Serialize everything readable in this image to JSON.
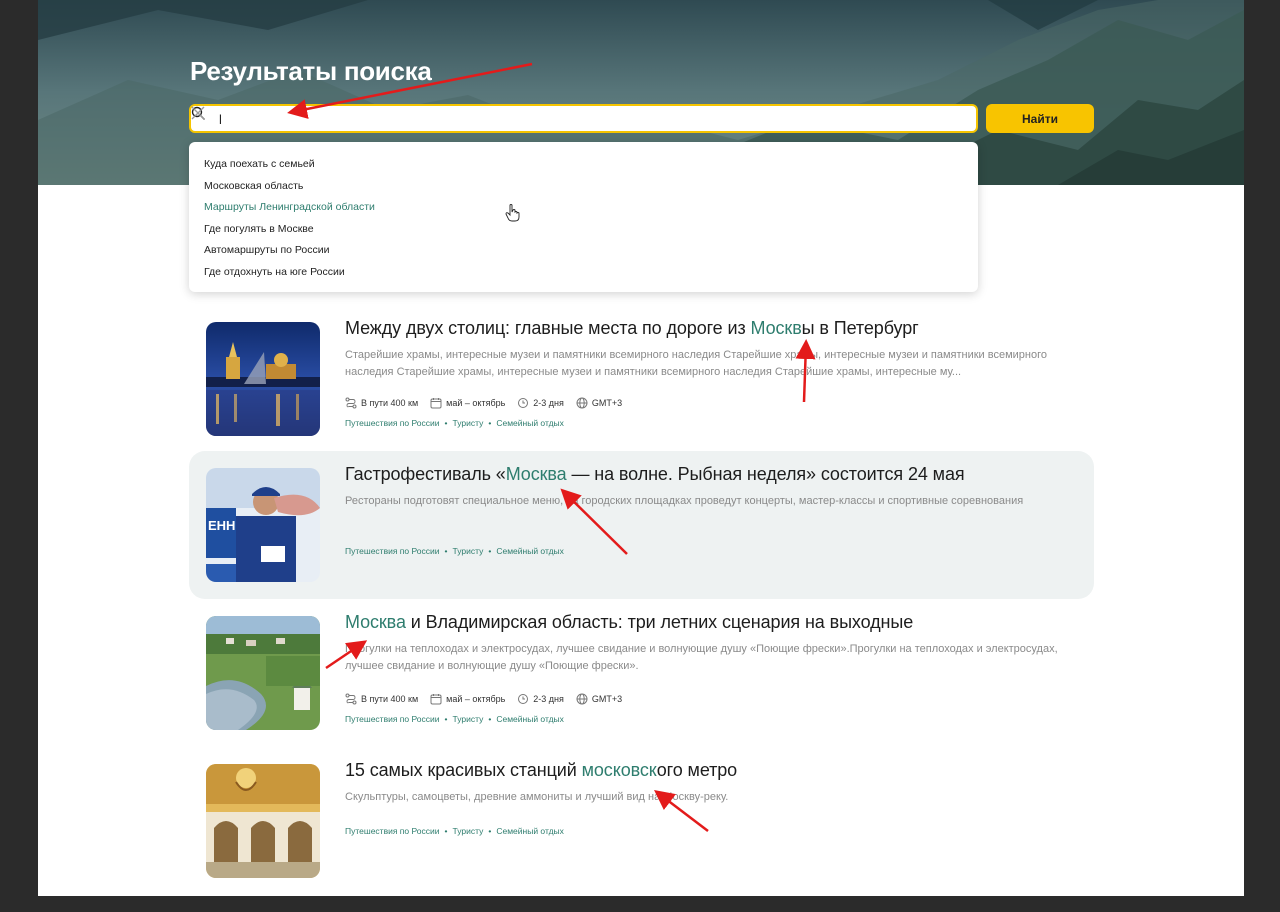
{
  "header": {
    "title": "Результаты поиска"
  },
  "search": {
    "value": "l",
    "placeholder": "",
    "button_label": "Найти"
  },
  "suggestions": [
    "Куда поехать с семьей",
    "Московская область",
    "Маршруты Ленинградской области",
    "Где погулять в Москве",
    "Автомаршруты по России",
    "Где отдохнуть на юге России"
  ],
  "active_suggestion_index": 2,
  "results": [
    {
      "title_before": "Между двух столиц: главные места по дороге из ",
      "title_mark": "Москв",
      "title_after": "ы в Петербург",
      "description": "Старейшие храмы, интересные музеи и памятники всемирного наследия Старейшие храмы, интересные музеи и памятники всемирного наследия Старейшие храмы, интересные музеи и памятники всемирного наследия Старейшие храмы, интересные му...",
      "meta": {
        "distance": "В пути 400 км",
        "season": "май – октябрь",
        "duration": "2-3 дня",
        "timezone": "GMT+3"
      },
      "tags": [
        "Путешествия по России",
        "Туристу",
        "Семейный отдых"
      ]
    },
    {
      "title_before": "Гастрофестиваль «",
      "title_mark": "Москва",
      "title_after": " — на волне. Рыбная неделя» состоится 24 мая",
      "description": "Рестораны подготовят специальное меню, на городских площадках проведут концерты, мастер-классы и спортивные соревнования",
      "tags": [
        "Путешествия по России",
        "Туристу",
        "Семейный отдых"
      ]
    },
    {
      "title_before": "",
      "title_mark": "Москва",
      "title_after": " и Владимирская область: три летних сценария на выходные",
      "description": "Прогулки на теплоходах и электросудах, лучшее свидание и волнующие душу «Поющие фрески».Прогулки на теплоходах и электросудах, лучшее свидание и волнующие душу «Поющие фрески».",
      "meta": {
        "distance": "В пути 400 км",
        "season": "май – октябрь",
        "duration": "2-3 дня",
        "timezone": "GMT+3"
      },
      "tags": [
        "Путешествия по России",
        "Туристу",
        "Семейный отдых"
      ]
    },
    {
      "title_before": "15 самых красивых станций ",
      "title_mark": "московск",
      "title_after": "ого метро",
      "description": "Скульптуры, самоцветы, древние аммониты и лучший вид на Москву-реку.",
      "tags": [
        "Путешествия по России",
        "Туристу",
        "Семейный отдых"
      ]
    }
  ],
  "colors": {
    "accent": "#f8c400",
    "highlight": "#2e7d6e",
    "annotation_arrow": "#e31b1b"
  },
  "icons": [
    "search-icon",
    "clear-icon",
    "cursor-hand-icon",
    "route-icon",
    "calendar-icon",
    "clock-icon",
    "globe-icon"
  ]
}
